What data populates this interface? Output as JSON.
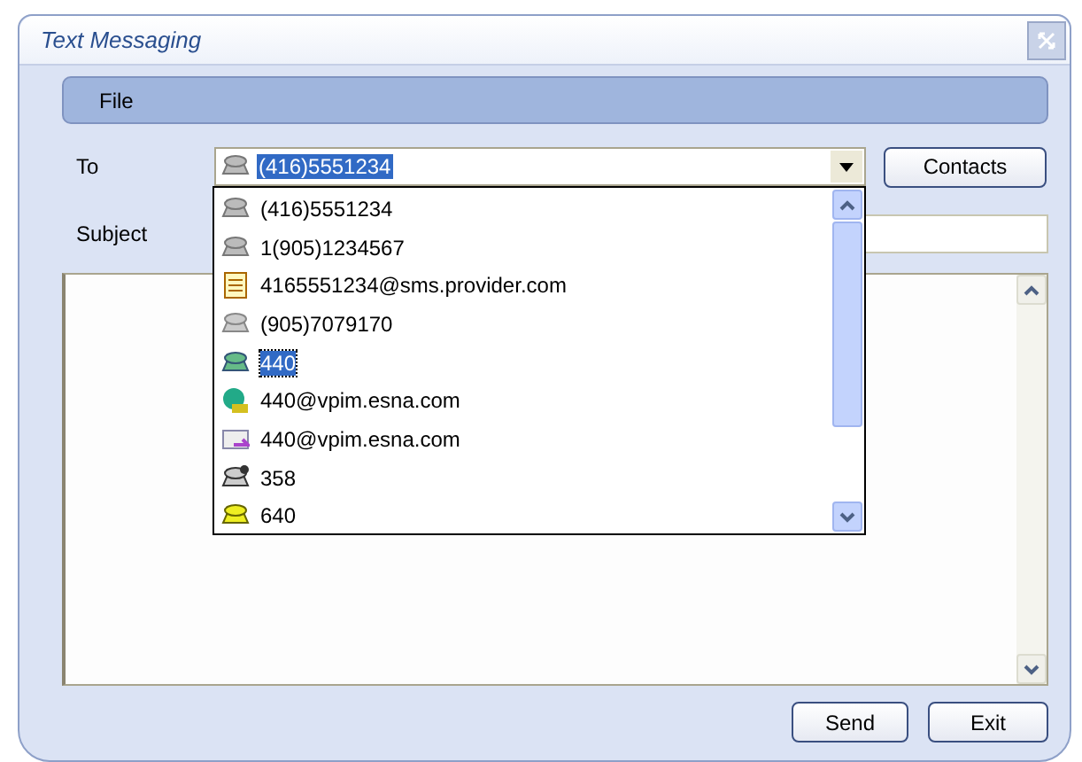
{
  "window": {
    "title": "Text Messaging"
  },
  "menu": [
    "File"
  ],
  "to": {
    "label": "To",
    "value": "(416)5551234",
    "kind": "phone",
    "expanded": true
  },
  "contacts_button": "Contacts",
  "subject": {
    "label": "Subject"
  },
  "dropdown": [
    {
      "text": "(416)5551234",
      "kind": "phone",
      "selected": false
    },
    {
      "text": "1(905)1234567",
      "kind": "phone",
      "selected": false
    },
    {
      "text": "4165551234@sms.provider.com",
      "kind": "card",
      "selected": false
    },
    {
      "text": "(905)7079170",
      "kind": "fax",
      "selected": false
    },
    {
      "text": "440",
      "kind": "desk",
      "selected": true
    },
    {
      "text": "440@vpim.esna.com",
      "kind": "globe",
      "selected": false
    },
    {
      "text": "440@vpim.esna.com",
      "kind": "mail",
      "selected": false
    },
    {
      "text": "358",
      "kind": "faxcheck",
      "selected": false
    },
    {
      "text": "640",
      "kind": "yellowphone",
      "selected": false
    }
  ],
  "buttons": [
    "Send",
    "Exit"
  ]
}
